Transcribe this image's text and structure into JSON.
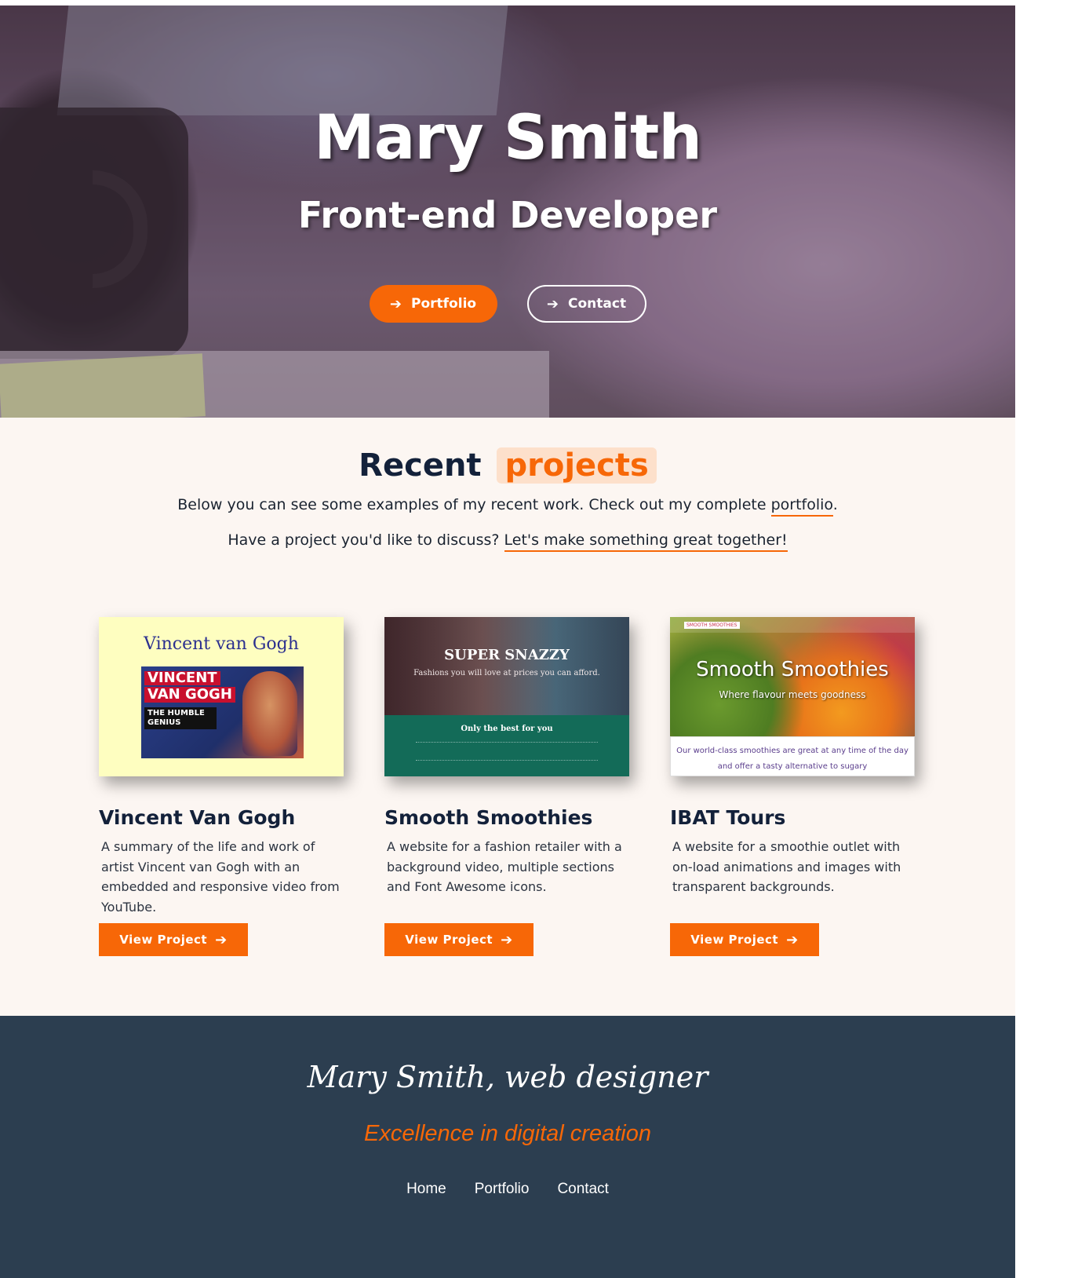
{
  "hero": {
    "name": "Mary Smith",
    "role": "Front-end Developer",
    "portfolio_label": "Portfolio",
    "contact_label": "Contact"
  },
  "projects": {
    "title_main": "Recent",
    "title_highlight": "projects",
    "intro_1_pre": "Below you can see some examples of my recent work. Check out my complete ",
    "intro_1_link": "portfolio",
    "intro_1_post": ".",
    "intro_2_pre": "Have a project you'd like to discuss? ",
    "intro_2_link": "Let's make something great together!",
    "cards": [
      {
        "title": "Vincent Van Gogh",
        "description": "A summary of the life and work of artist Vincent van Gogh with an embedded and responsive video from YouTube.",
        "button": "View Project",
        "thumb_title": "Vincent van Gogh",
        "thumb_line1": "VINCENT",
        "thumb_line2": "VAN GOGH",
        "thumb_line3": "THE HUMBLE GENIUS"
      },
      {
        "title": "Smooth Smoothies",
        "description": "A website for a fashion retailer with a background video, multiple sections and Font Awesome icons.",
        "button": "View Project",
        "thumb_title": "SUPER SNAZZY",
        "thumb_sub": "Fashions you will love at prices you can afford.",
        "thumb_band": "Only the best for you"
      },
      {
        "title": "IBAT Tours",
        "description": "A website for a smoothie outlet with on-load animations and images with transparent backgrounds.",
        "button": "View Project",
        "thumb_logo": "SMOOTH SMOOTHIES",
        "thumb_title": "Smooth Smoothies",
        "thumb_sub": "Where flavour meets goodness",
        "thumb_body": "Our world-class smoothies are great at any time of the day and offer a tasty alternative to sugary"
      }
    ]
  },
  "footer": {
    "title": "Mary Smith, web designer",
    "tagline": "Excellence in digital creation",
    "nav": [
      "Home",
      "Portfolio",
      "Contact"
    ]
  },
  "colors": {
    "accent": "#f76707",
    "footer_bg": "#2c3e50",
    "section_bg": "#fcf6f2"
  },
  "icons": {
    "button_arrow": "arrow-right-icon"
  }
}
